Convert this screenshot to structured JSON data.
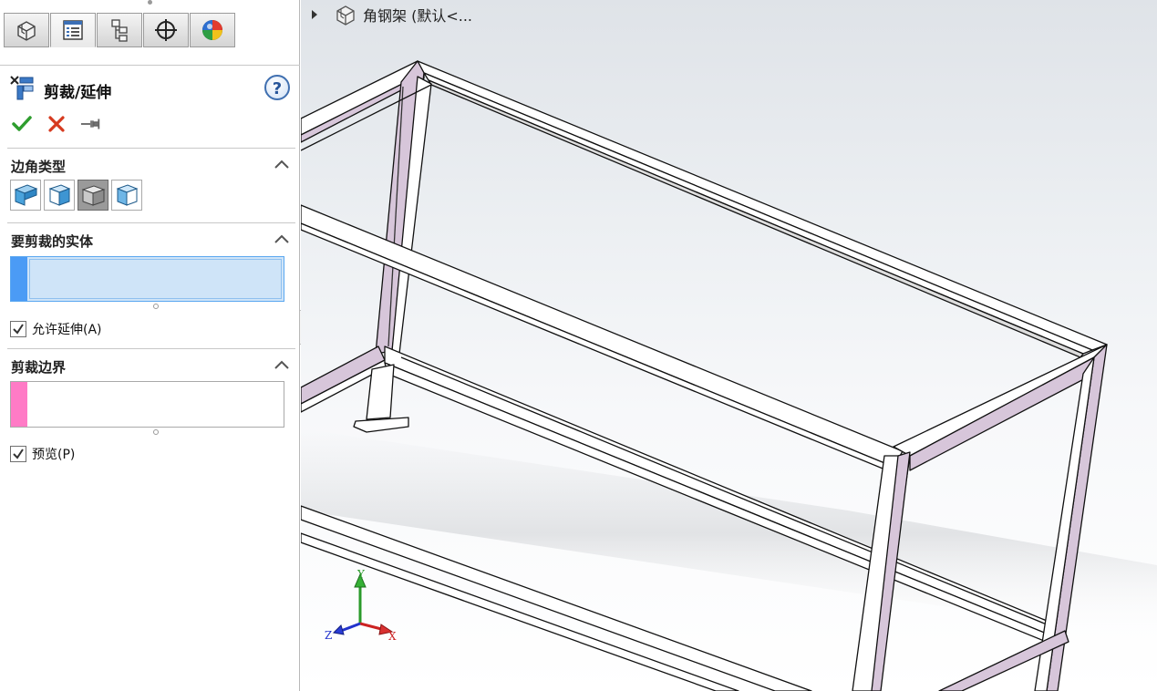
{
  "manager_tabs": [
    {
      "icon": "feature-manager-icon",
      "active": false
    },
    {
      "icon": "property-manager-icon",
      "active": true
    },
    {
      "icon": "configuration-manager-icon",
      "active": false
    },
    {
      "icon": "dimxpert-manager-icon",
      "active": false
    },
    {
      "icon": "display-manager-icon",
      "active": false
    }
  ],
  "feature": {
    "title": "剪裁/延伸",
    "help_label": "?",
    "actions": [
      "ok-icon",
      "cancel-icon",
      "pushpin-icon"
    ]
  },
  "sections": {
    "corner_type": {
      "title": "边角类型",
      "buttons": [
        "end-trim-icon",
        "end-miter-icon",
        "end-butt1-icon",
        "end-butt2-icon"
      ],
      "selected_index": 2
    },
    "bodies_to_trim": {
      "title": "要剪裁的实体",
      "allow_extension_label": "允许延伸(A)",
      "allow_extension_checked": true
    },
    "trim_boundary": {
      "title": "剪裁边界",
      "preview_label": "预览(P)",
      "preview_checked": true
    }
  },
  "graphics": {
    "tree_item_label": "角钢架  (默认<...",
    "axes": {
      "x": "X",
      "y": "Y",
      "z": "Z"
    },
    "colors": {
      "frame_fill": "#ffffff",
      "frame_side": "#cdb9d0",
      "outline": "#111111",
      "x_axis": "#cc2222",
      "y_axis": "#2a9a2a",
      "z_axis": "#2233cc"
    }
  }
}
